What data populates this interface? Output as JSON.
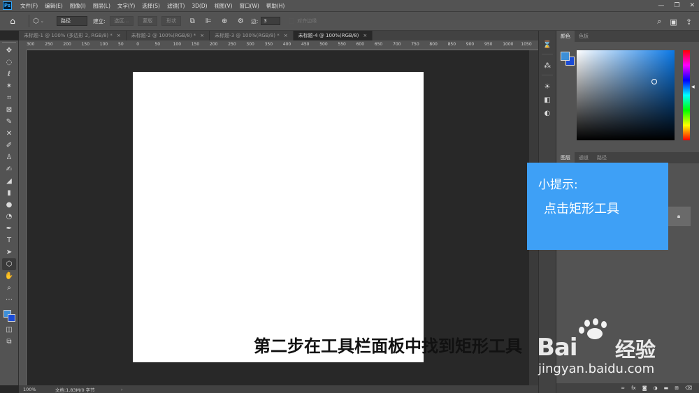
{
  "app": {
    "logo": "Ps",
    "menu": [
      "文件(F)",
      "编辑(E)",
      "图像(I)",
      "图层(L)",
      "文字(Y)",
      "选择(S)",
      "滤镜(T)",
      "3D(D)",
      "视图(V)",
      "窗口(W)",
      "帮助(H)"
    ]
  },
  "options_bar": {
    "mode_select": "路径",
    "make_label": "建立:",
    "selection_btn": "选区...",
    "mask_btn": "蒙版",
    "shape_btn": "形状",
    "radius_label": "边:",
    "radius_value": "3",
    "align_edges_label": "对齐边缘"
  },
  "tabs": [
    {
      "label": "未标题-1 @ 100% (多边形 2, RGB/8) *",
      "close": "×"
    },
    {
      "label": "未标题-2 @ 100%(RGB/8) *",
      "close": "×"
    },
    {
      "label": "未标题-3 @ 100%(RGB/8) *",
      "close": "×"
    },
    {
      "label": "未标题-4 @ 100%(RGB/8)",
      "close": "×"
    }
  ],
  "ruler_labels": [
    "300",
    "250",
    "200",
    "150",
    "100",
    "50",
    "0",
    "50",
    "100",
    "150",
    "200",
    "250",
    "300",
    "350",
    "400",
    "450",
    "500",
    "550",
    "600",
    "650",
    "700",
    "750",
    "800",
    "850",
    "900",
    "950",
    "1000",
    "1050"
  ],
  "tools": [
    "move-icon",
    "marquee-icon",
    "lasso-icon",
    "magic-wand-icon",
    "crop-icon",
    "frame-icon",
    "eyedropper-icon",
    "healing-icon",
    "brush-icon",
    "stamp-icon",
    "history-brush-icon",
    "eraser-icon",
    "gradient-icon",
    "blur-icon",
    "dodge-icon",
    "pen-icon",
    "type-icon",
    "path-select-icon",
    "shape-icon",
    "hand-icon",
    "zoom-icon",
    "more-icon"
  ],
  "status": {
    "zoom": "100%",
    "doc": "文档:1.83M/0 字节",
    "arrow": "›"
  },
  "color_panel": {
    "tabs": [
      "颜色",
      "色板"
    ],
    "foreground": "#3d8fd8",
    "background": "#1a4bd6"
  },
  "layers_panel": {
    "tabs": [
      "图层",
      "通道",
      "路径"
    ]
  },
  "tip": {
    "title": "小提示:",
    "body": "点击矩形工具"
  },
  "caption": "第二步在工具栏面板中找到矩形工具",
  "watermark": {
    "brand": "Bai",
    "brand2": "经验",
    "url": "jingyan.baidu.com"
  },
  "colors": {
    "tip_bg": "#3ea0f6",
    "ui_dark": "#282828",
    "ui_mid": "#535353"
  }
}
